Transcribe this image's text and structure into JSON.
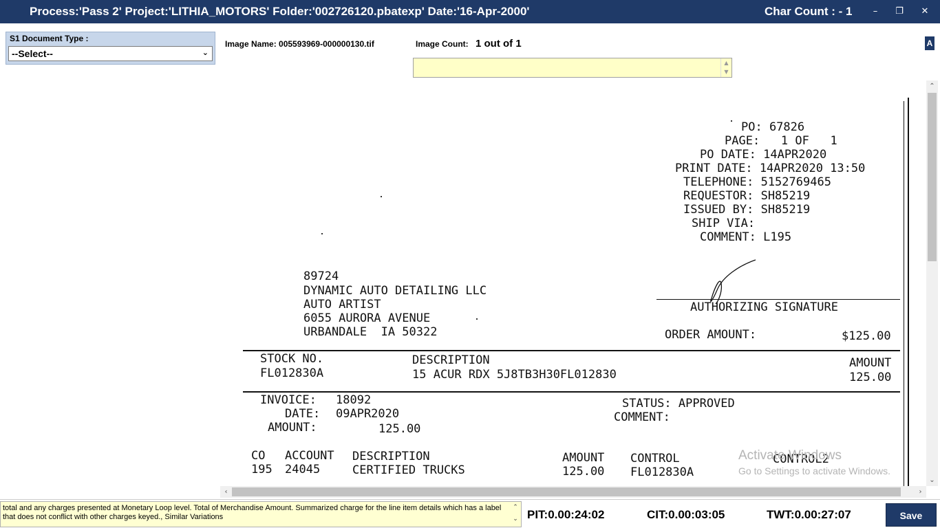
{
  "titlebar": {
    "title": "Process:'Pass 2' Project:'LITHIA_MOTORS' Folder:'002726120.pbatexp' Date:'16-Apr-2000'",
    "char_count": "Char Count : - 1",
    "minimize_glyph": "–",
    "restore_glyph": "❐",
    "close_glyph": "✕"
  },
  "panel": {
    "doc_type_label": "S1 Document Type :",
    "doc_type_selected": "--Select--",
    "image_name": "Image Name: 005593969-000000130.tif",
    "image_count_label": "Image Count:",
    "image_count_value": "1 out of 1",
    "badge": "A"
  },
  "document": {
    "po_lines": [
      "PO: 67826",
      "PAGE:   1 OF   1",
      "PO DATE: 14APR2020",
      "PRINT DATE: 14APR2020 13:50",
      "TELEPHONE: 5152769465",
      "REQUESTOR: SH85219",
      "ISSUED BY: SH85219",
      "SHIP VIA:",
      "COMMENT: L195"
    ],
    "vendor_lines": [
      "89724",
      "DYNAMIC AUTO DETAILING LLC",
      "AUTO ARTIST",
      "6055 AURORA AVENUE",
      "URBANDALE  IA 50322"
    ],
    "authorizing_signature": "AUTHORIZING SIGNATURE",
    "order_amount_label": "ORDER AMOUNT:",
    "order_amount_value": "$125.00",
    "stock_no_header": "STOCK NO.",
    "description_header": "DESCRIPTION",
    "amount_header": "AMOUNT",
    "stock_no": "FL012830A",
    "description": "15 ACUR RDX 5J8TB3H30FL012830",
    "amount": "125.00",
    "invoice_label": "INVOICE:",
    "invoice_value": "18092",
    "date_label": "DATE:",
    "date_value": "09APR2020",
    "inv_amount_label": "AMOUNT:",
    "inv_amount_value": "125.00",
    "status_line": "STATUS: APPROVED",
    "comment_line": "COMMENT:",
    "acct_headers": {
      "co": "CO",
      "account": "ACCOUNT",
      "description": "DESCRIPTION",
      "amount": "AMOUNT",
      "control": "CONTROL",
      "control2": "CONTROL2"
    },
    "acct_row": {
      "co": "195",
      "account": "24045",
      "description": "CERTIFIED TRUCKS",
      "amount": "125.00",
      "control": "FL012830A"
    }
  },
  "watermark": {
    "line1": "Activate Windows",
    "line2": "Go to Settings to activate Windows."
  },
  "bottom": {
    "hint_text": "total and any charges presented at Monetary Loop level. Total of Merchandise Amount. Summarized charge for the line item details which has a label that does not conflict with other charges keyed., Similar Variations",
    "pit": "PIT:0.00:24:02",
    "cit": "CIT:0.00:03:05",
    "twt": "TWT:0.00:27:07",
    "save_label": "Save"
  },
  "colors": {
    "titlebar_bg": "#1f3a68",
    "input_yellow": "#ffffc8",
    "panel_blue": "#c7d6ea"
  }
}
